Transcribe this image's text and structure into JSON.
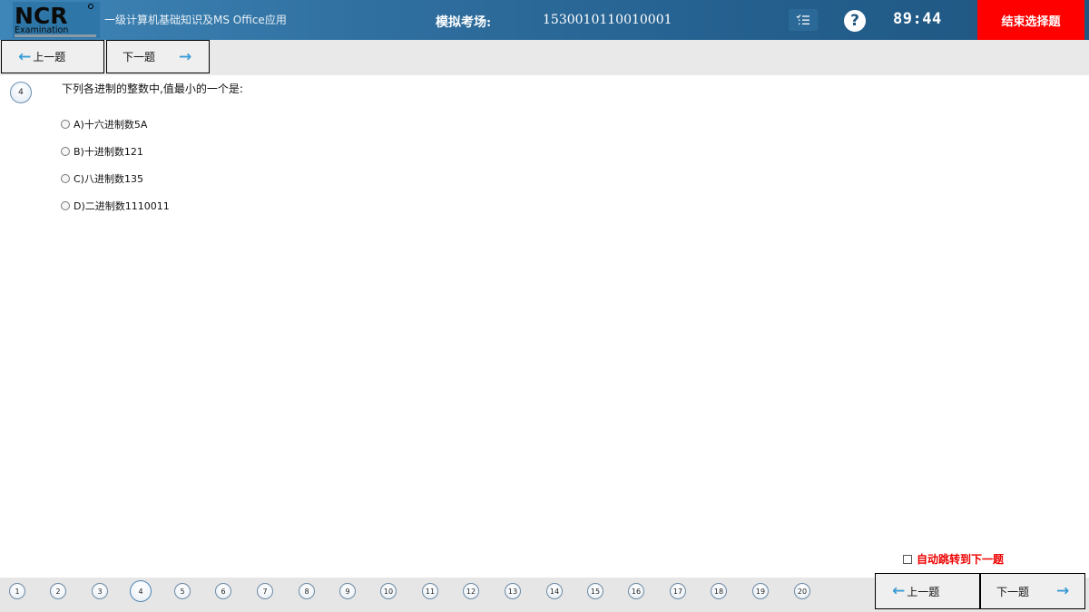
{
  "header": {
    "logo_text": "NCR",
    "logo_sub": "Examination",
    "subject": "一级计算机基础知识及MS Office应用",
    "exam_label": "模拟考场:",
    "exam_number": "1530010110010001",
    "timer": "89:44",
    "end_button": "结束选择题",
    "help_glyph": "?"
  },
  "nav": {
    "prev_label": "上一题",
    "next_label": "下一题",
    "prev_arrow": "←",
    "next_arrow": "→"
  },
  "question": {
    "number": "4",
    "text": "下列各进制的整数中,值最小的一个是:",
    "options": [
      "A)十六进制数5A",
      "B)十进制数121",
      "C)八进制数135",
      "D)二进制数1110011"
    ]
  },
  "auto_next_label": "自动跳转到下一题",
  "question_numbers": [
    "1",
    "2",
    "3",
    "4",
    "5",
    "6",
    "7",
    "8",
    "9",
    "10",
    "11",
    "12",
    "13",
    "14",
    "15",
    "16",
    "17",
    "18",
    "19",
    "20"
  ],
  "current_question": "4",
  "colors": {
    "header_bg": "#245f8e",
    "end_button_bg": "#ff0000",
    "arrow": "#3b9bd5",
    "auto_next_text": "#ee0000"
  },
  "icons": {
    "list": "list-icon",
    "help": "help-icon",
    "radio": "radio-icon",
    "checkbox": "checkbox-icon"
  }
}
